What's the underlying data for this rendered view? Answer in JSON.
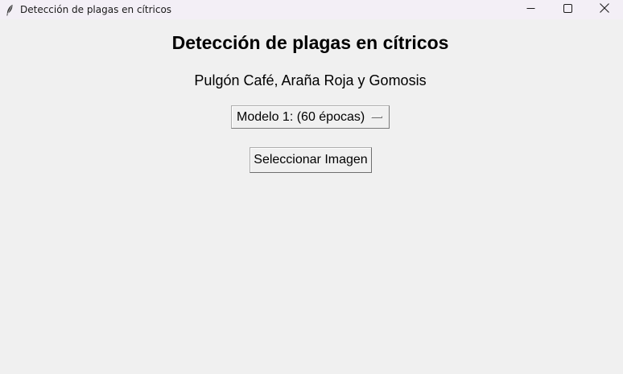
{
  "window": {
    "title": "Detección de plagas en cítricos",
    "icon": "feather-icon",
    "controls": {
      "minimize_icon": "minimize-icon",
      "maximize_icon": "maximize-icon",
      "close_icon": "close-icon"
    }
  },
  "main": {
    "heading": "Detección de plagas en cítricos",
    "subheading": "Pulgón Café, Araña Roja y Gomosis",
    "model_select": {
      "selected": "Modelo 1: (60 épocas)"
    },
    "select_image_button": "Seleccionar Imagen"
  },
  "colors": {
    "titlebar_bg": "#f3eff6",
    "window_bg": "#f0f0f0"
  }
}
